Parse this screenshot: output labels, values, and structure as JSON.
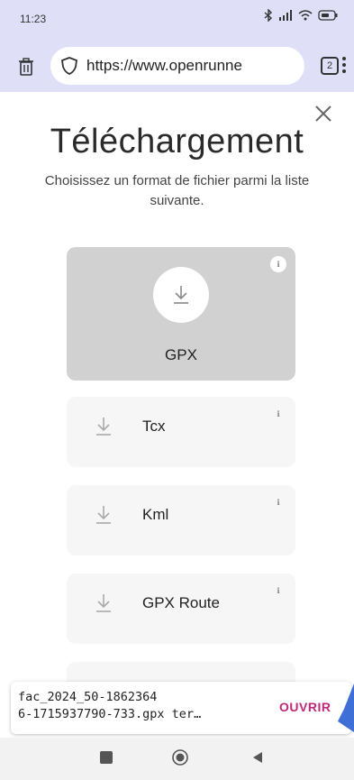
{
  "status_bar": {
    "time": "11:23",
    "icons": [
      "bluetooth-icon",
      "signal-icon",
      "wifi-icon",
      "battery-icon"
    ]
  },
  "browser": {
    "url": "https://www.openrunne",
    "tab_count": "2"
  },
  "dialog": {
    "title": "Téléchargement",
    "subtitle": "Choisissez un format de fichier parmi la liste suivante.",
    "options": [
      {
        "label": "GPX",
        "selected": true
      },
      {
        "label": "Tcx",
        "selected": false
      },
      {
        "label": "Kml",
        "selected": false
      },
      {
        "label": "GPX Route",
        "selected": false
      }
    ],
    "info_glyph": "ℹ"
  },
  "snackbar": {
    "line1": "fac_2024_50-1862364",
    "line2": "6-1715937790-733.gpx ter…",
    "action": "OUVRIR",
    "action_color": "#c0287a"
  },
  "colors": {
    "browser_chrome": "#dfe0f7",
    "selected_card": "#d1d1d1",
    "card": "#f6f6f6"
  }
}
